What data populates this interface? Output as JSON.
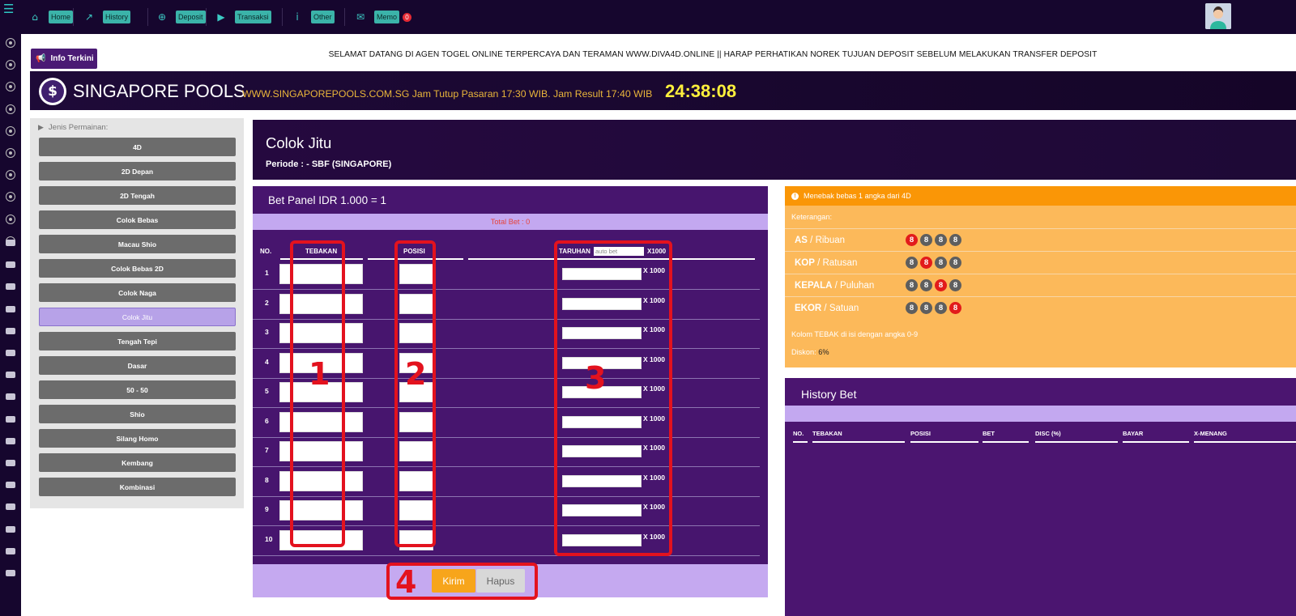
{
  "topnav": {
    "items": [
      {
        "label": "Home",
        "icon": "home-icon"
      },
      {
        "label": "History",
        "icon": "chart-line-icon"
      },
      {
        "label": "Deposit",
        "icon": "plus-circle-icon"
      },
      {
        "label": "Transaksi",
        "icon": "play-icon"
      },
      {
        "label": "Other",
        "icon": "info-icon"
      },
      {
        "label": "Memo",
        "icon": "envelope-icon",
        "badge": "0"
      }
    ]
  },
  "info": {
    "button": "Info Terkini",
    "marquee": "SELAMAT DATANG DI AGEN TOGEL ONLINE TERPERCAYA DAN TERAMAN WWW.DIVA4D.ONLINE || HARAP PERHATIKAN NOREK TUJUAN DEPOSIT SEBELUM MELAKUKAN TRANSFER DEPOSIT"
  },
  "market": {
    "name": "SINGAPORE POOLS",
    "details": "WWW.SINGAPOREPOOLS.COM.SG Jam Tutup Pasaran 17:30 WIB. Jam Result 17:40 WIB",
    "countdown": "24:38:08",
    "logo_symbol": "$"
  },
  "games": {
    "heading": "Jenis Permainan:",
    "items": [
      "4D",
      "2D Depan",
      "2D Tengah",
      "Colok Bebas",
      "Macau Shio",
      "Colok Bebas 2D",
      "Colok Naga",
      "Colok Jitu",
      "Tengah Tepi",
      "Dasar",
      "50 - 50",
      "Shio",
      "Silang Homo",
      "Kembang",
      "Kombinasi"
    ],
    "active": "Colok Jitu"
  },
  "page": {
    "title": "Colok Jitu",
    "periode": "Periode : - SBF (SINGAPORE)"
  },
  "bet_panel": {
    "title": "Bet Panel IDR 1.000 = 1",
    "total": "Total Bet : 0",
    "columns": {
      "no": "NO.",
      "tebakan": "TEBAKAN",
      "posisi": "POSISI",
      "taruhan": "TARUHAN",
      "x1000": "X1000"
    },
    "autobet_placeholder": "auto bet",
    "multiplier": "X 1000",
    "rows": [
      "1",
      "2",
      "3",
      "4",
      "5",
      "6",
      "7",
      "8",
      "9",
      "10"
    ],
    "submit": "Kirim",
    "reset": "Hapus"
  },
  "annotations": [
    "1",
    "2",
    "3",
    "4"
  ],
  "rules": {
    "header": "Menebak bebas 1 angka dari 4D",
    "keterangan": "Keterangan:",
    "positions": [
      {
        "bold": "AS",
        "rest": " / Ribuan",
        "digits": [
          "8",
          "8",
          "8",
          "8"
        ],
        "hot": 0
      },
      {
        "bold": "KOP",
        "rest": " / Ratusan",
        "digits": [
          "8",
          "8",
          "8",
          "8"
        ],
        "hot": 1
      },
      {
        "bold": "KEPALA",
        "rest": " / Puluhan",
        "digits": [
          "8",
          "8",
          "8",
          "8"
        ],
        "hot": 2
      },
      {
        "bold": "EKOR",
        "rest": " / Satuan",
        "digits": [
          "8",
          "8",
          "8",
          "8"
        ],
        "hot": 3
      }
    ],
    "note": "Kolom TEBAK di isi dengan angka 0-9",
    "diskon_label": "Diskon: ",
    "diskon_value": "6%"
  },
  "history": {
    "title": "History Bet",
    "columns": [
      "NO.",
      "TEBAKAN",
      "POSISI",
      "BET",
      "DISC (%)",
      "BAYAR",
      "X-MENANG"
    ]
  },
  "colors": {
    "top": "#16062e",
    "panel": "#47156e",
    "accent": "#c3a8f0",
    "orange": "#fa9606",
    "red": "#e3121e"
  }
}
